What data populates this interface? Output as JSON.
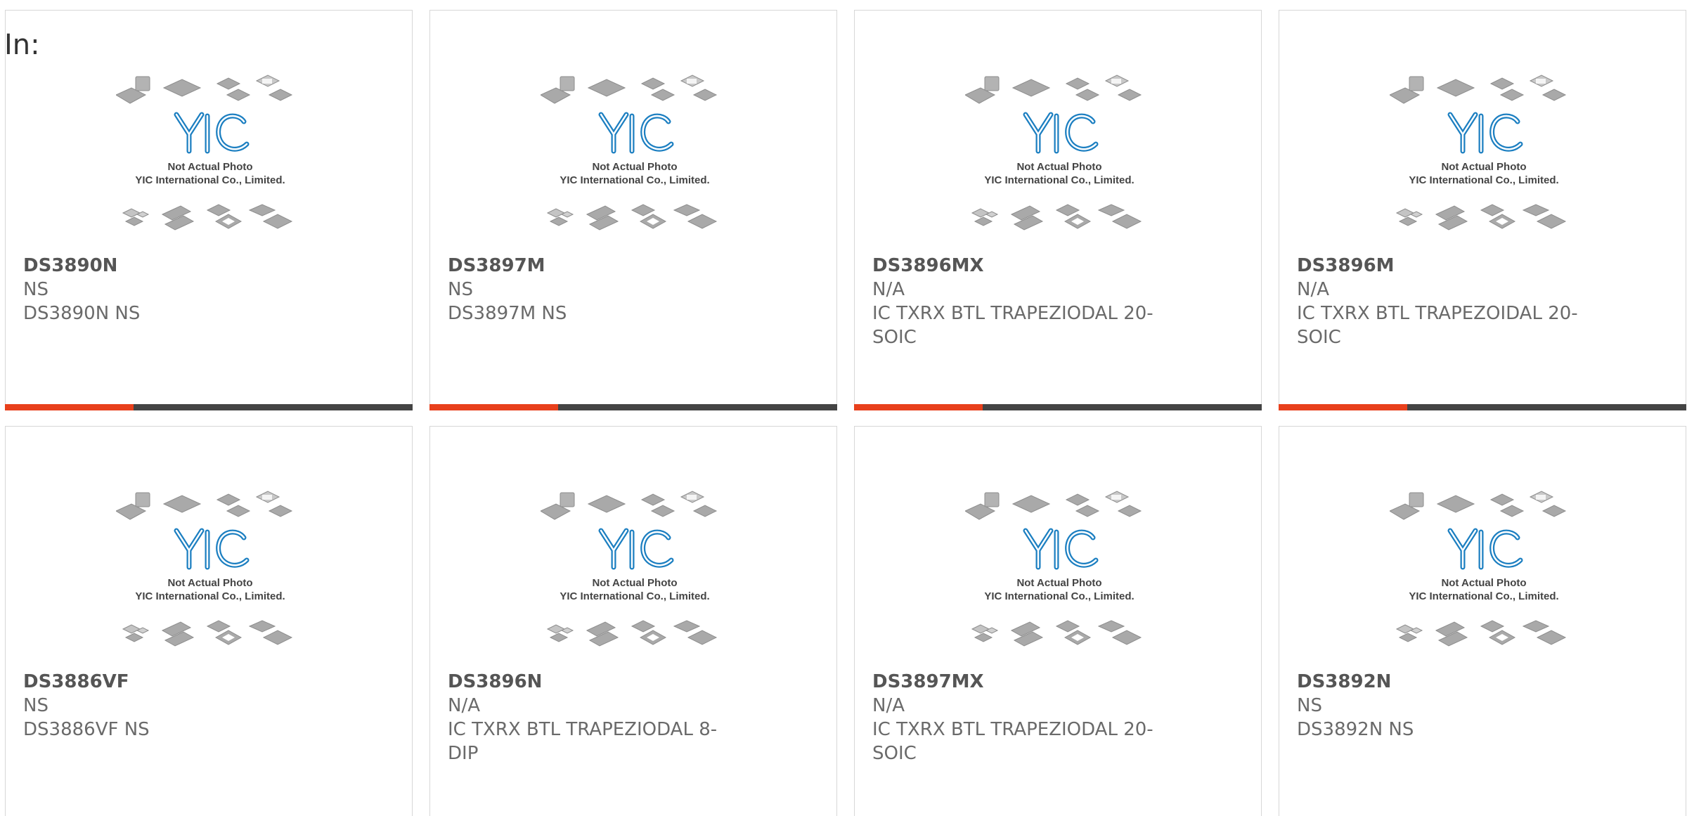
{
  "page": {
    "in_label": "In:"
  },
  "image_placeholder": {
    "caption_line1": "Not Actual Photo",
    "caption_line2": "YIC International Co., Limited.",
    "logo_text": "YIC"
  },
  "colors": {
    "accent": "#e8401c",
    "bar": "#444444",
    "logo_blue": "#1c7fc1",
    "text_muted": "#6a6a6a"
  },
  "products": [
    {
      "part_number": "DS3890N",
      "manufacturer": "NS",
      "description": "DS3890N NS"
    },
    {
      "part_number": "DS3897M",
      "manufacturer": "NS",
      "description": "DS3897M NS"
    },
    {
      "part_number": "DS3896MX",
      "manufacturer": "N/A",
      "description": "IC TXRX BTL TRAPEZIODAL 20-SOIC"
    },
    {
      "part_number": "DS3896M",
      "manufacturer": "N/A",
      "description": "IC TXRX BTL TRAPEZOIDAL 20-SOIC"
    },
    {
      "part_number": "DS3886VF",
      "manufacturer": "NS",
      "description": "DS3886VF NS"
    },
    {
      "part_number": "DS3896N",
      "manufacturer": "N/A",
      "description": "IC TXRX BTL TRAPEZIODAL 8-DIP"
    },
    {
      "part_number": "DS3897MX",
      "manufacturer": "N/A",
      "description": "IC TXRX BTL TRAPEZIODAL 20-SOIC"
    },
    {
      "part_number": "DS3892N",
      "manufacturer": "NS",
      "description": "DS3892N NS"
    }
  ]
}
